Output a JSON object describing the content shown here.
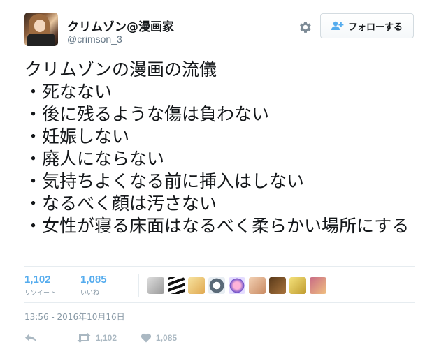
{
  "user": {
    "display_name": "クリムゾン@漫画家",
    "handle": "@crimson_3"
  },
  "follow_button": {
    "label": "フォロー",
    "suffix": "する"
  },
  "tweet": {
    "lines": [
      "クリムゾンの漫画の流儀",
      "・死なない",
      "・後に残るような傷は負わない",
      "・妊娠しない",
      "・廃人にならない",
      "・気持ちよくなる前に挿入はしない",
      "・なるべく顔は汚さない",
      "・女性が寝る床面はなるべく柔らかい場所にする"
    ]
  },
  "stats": {
    "retweets": {
      "count": "1,102",
      "label": "リツイート"
    },
    "likes": {
      "count": "1,085",
      "label": "いいね"
    }
  },
  "timestamp": "13:56 - 2016年10月16日",
  "actions": {
    "retweet_count": "1,102",
    "like_count": "1,085"
  },
  "colors": {
    "accent": "#55acee",
    "muted": "#8899a6"
  }
}
